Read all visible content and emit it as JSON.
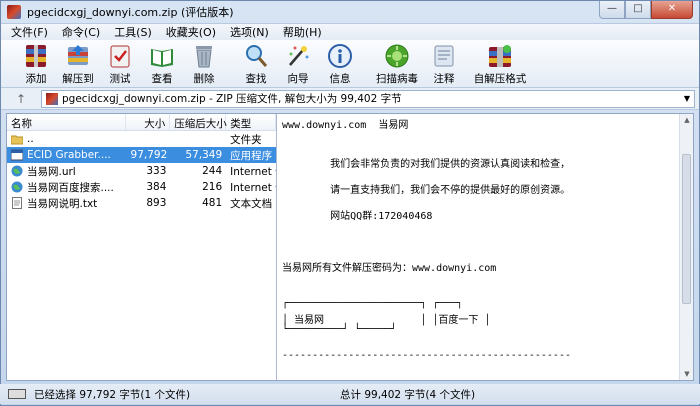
{
  "window": {
    "title": "pgecidcxgj_downyi.com.zip (评估版本)"
  },
  "menu": [
    "文件(F)",
    "命令(C)",
    "工具(S)",
    "收藏夹(O)",
    "选项(N)",
    "帮助(H)"
  ],
  "toolbar": [
    {
      "label": "添加",
      "icon": "add-icon"
    },
    {
      "label": "解压到",
      "icon": "extract-icon"
    },
    {
      "label": "测试",
      "icon": "test-icon"
    },
    {
      "label": "查看",
      "icon": "view-icon"
    },
    {
      "label": "删除",
      "icon": "delete-icon"
    },
    {
      "label": "查找",
      "icon": "find-icon"
    },
    {
      "label": "向导",
      "icon": "wizard-icon"
    },
    {
      "label": "信息",
      "icon": "info-icon"
    },
    {
      "label": "扫描病毒",
      "icon": "virus-scan-icon"
    },
    {
      "label": "注释",
      "icon": "comment-icon"
    },
    {
      "label": "自解压格式",
      "icon": "sfx-icon"
    }
  ],
  "address": {
    "path": "pgecidcxgj_downyi.com.zip - ZIP 压缩文件, 解包大小为 99,402 字节"
  },
  "columns": {
    "name": "名称",
    "size": "大小",
    "packed": "压缩后大小",
    "type": "类型"
  },
  "files": [
    {
      "name": "..",
      "size": "",
      "packed": "",
      "type": "文件夹",
      "icon": "folder-icon",
      "selected": false
    },
    {
      "name": "ECID Grabber....",
      "size": "97,792",
      "packed": "57,349",
      "type": "应用程序",
      "icon": "exe-icon",
      "selected": true
    },
    {
      "name": "当易网.url",
      "size": "333",
      "packed": "244",
      "type": "Internet 快",
      "icon": "globe-icon",
      "selected": false
    },
    {
      "name": "当易网百度搜索....",
      "size": "384",
      "packed": "216",
      "type": "Internet 快",
      "icon": "globe-icon",
      "selected": false
    },
    {
      "name": "当易网说明.txt",
      "size": "893",
      "packed": "481",
      "type": "文本文档",
      "icon": "txt-icon",
      "selected": false
    }
  ],
  "comment": {
    "lines": [
      "www.downyi.com  当易网",
      "",
      "",
      "        我们会非常负责的对我们提供的资源认真阅读和检查，",
      "",
      "        请一直支持我们，我们会不停的提供最好的原创资源。",
      "",
      "        网站QQ群:172040468",
      "",
      "",
      "",
      "当易网所有文件解压密码为：www.downyi.com",
      "",
      "",
      "┌──────────────────────┐ ┌───┐",
      "│ 当易网                │ │百度一下 │",
      "└─────────┘ └─────┘",
      "",
      "------------------------------------------------"
    ]
  },
  "status": {
    "left": "已经选择 97,792 字节(1 个文件)",
    "right": "总计 99,402 字节(4 个文件)"
  }
}
